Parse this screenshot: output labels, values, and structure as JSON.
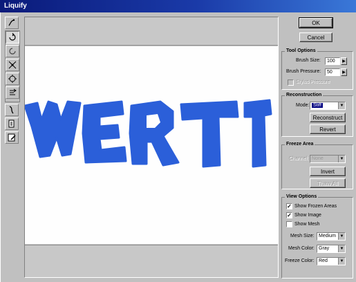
{
  "window": {
    "title": "Liquify"
  },
  "buttons": {
    "ok": "OK",
    "cancel": "Cancel"
  },
  "tool_options": {
    "title": "Tool Options",
    "brush_size_label": "Brush Size:",
    "brush_size_value": "100",
    "brush_pressure_label": "Brush Pressure:",
    "brush_pressure_value": "50",
    "stylus_pressure_label": "Stylus Pressure",
    "stylus_pressure_checked": false
  },
  "reconstruction": {
    "title": "Reconstruction",
    "mode_label": "Mode:",
    "mode_value": "Stiff",
    "reconstruct_label": "Reconstruct",
    "revert_label": "Revert"
  },
  "freeze_area": {
    "title": "Freeze Area",
    "channel_label": "Channel:",
    "channel_value": "None",
    "invert_label": "Invert",
    "thaw_all_label": "Thaw All"
  },
  "view_options": {
    "title": "View Options",
    "show_frozen_areas_label": "Show Frozen Areas",
    "show_frozen_areas_checked": true,
    "show_image_label": "Show Image",
    "show_image_checked": true,
    "show_mesh_label": "Show Mesh",
    "show_mesh_checked": false,
    "mesh_size_label": "Mesh Size:",
    "mesh_size_value": "Medium",
    "mesh_color_label": "Mesh Color:",
    "mesh_color_value": "Gray",
    "freeze_color_label": "Freeze Color:",
    "freeze_color_value": "Red"
  },
  "canvas": {
    "text": "WERT",
    "text_color": "#2b5fd9"
  },
  "tools": [
    "warp-tool",
    "twirl-clockwise-tool",
    "twirl-counterclockwise-tool",
    "pucker-tool",
    "bloat-tool",
    "shift-pixels-tool",
    "reflection-tool",
    "reconstruction-tool",
    "freeze-tool",
    "thaw-tool"
  ],
  "colors": {
    "titlebar_start": "#0a1a7a",
    "titlebar_end": "#3a78d8",
    "face": "#c0c0c0"
  }
}
